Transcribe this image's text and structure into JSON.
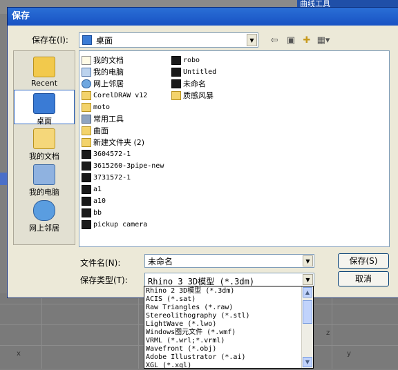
{
  "background": {
    "panel_title": "曲线工具",
    "axis_x": "x",
    "axis_y": "y",
    "axis_z": "z"
  },
  "dialog": {
    "title": "保存",
    "save_in_label": "保存在(I):",
    "save_in_value": "桌面",
    "places": [
      {
        "label": "Recent"
      },
      {
        "label": "桌面"
      },
      {
        "label": "我的文档"
      },
      {
        "label": "我的电脑"
      },
      {
        "label": "网上邻居"
      }
    ],
    "files_col1": [
      {
        "name": "我的文档",
        "icon": "my-documents-icon"
      },
      {
        "name": "我的电脑",
        "icon": "my-computer-icon"
      },
      {
        "name": "网上邻居",
        "icon": "network-icon"
      },
      {
        "name": "CorelDRAW v12",
        "icon": "folder-icon"
      },
      {
        "name": "moto",
        "icon": "folder-icon"
      },
      {
        "name": "常用工具",
        "icon": "tool-icon"
      },
      {
        "name": "曲面",
        "icon": "folder-icon"
      },
      {
        "name": "新建文件夹 (2)",
        "icon": "folder-icon"
      },
      {
        "name": "3604572-1",
        "icon": "rhino-file-icon"
      },
      {
        "name": "3615260-3pipe-new",
        "icon": "rhino-file-icon"
      },
      {
        "name": "3731572-1",
        "icon": "rhino-file-icon"
      },
      {
        "name": "a1",
        "icon": "rhino-file-icon"
      },
      {
        "name": "a10",
        "icon": "rhino-file-icon"
      },
      {
        "name": "bb",
        "icon": "rhino-file-icon"
      },
      {
        "name": "pickup camera",
        "icon": "rhino-file-icon"
      }
    ],
    "files_col2": [
      {
        "name": "robo",
        "icon": "rhino-file-icon"
      },
      {
        "name": "Untitled",
        "icon": "rhino-file-icon"
      },
      {
        "name": "未命名",
        "icon": "rhino-file-icon"
      },
      {
        "name": "质感风暴",
        "icon": "folder-icon"
      }
    ],
    "filename_label": "文件名(N):",
    "filename_value": "未命名",
    "filetype_label": "保存类型(T):",
    "filetype_value": "Rhino 3 3D模型 (*.3dm)",
    "save_button": "保存(S)",
    "cancel_button": "取消",
    "type_options": [
      "Rhino 2 3D模型 (*.3dm)",
      "ACIS (*.sat)",
      "Raw Triangles (*.raw)",
      "Stereolithography (*.stl)",
      "LightWave (*.lwo)",
      "Windows图元文件 (*.wmf)",
      "VRML (*.wrl;*.vrml)",
      "Wavefront (*.obj)",
      "Adobe Illustrator (*.ai)",
      "XGL (*.xgl)"
    ]
  }
}
